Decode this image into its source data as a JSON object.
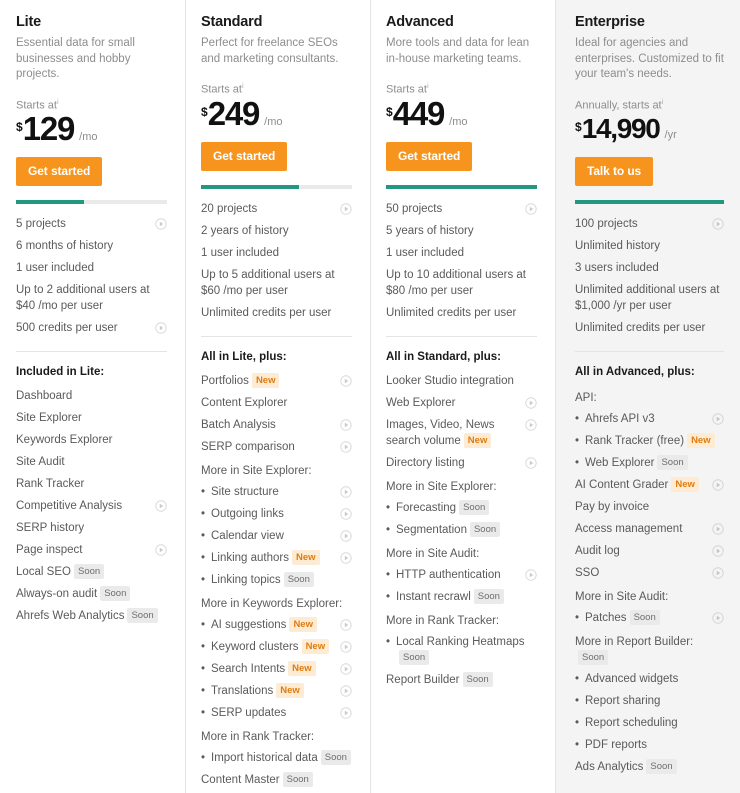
{
  "badges": {
    "new": "New",
    "soon": "Soon"
  },
  "colors": {
    "accent": "#f7941d",
    "meter": "#23977f",
    "badge_new_bg": "#fdecd3",
    "badge_new_text": "#e07b10",
    "featured_bg": "#f4f4f4"
  },
  "common": {
    "info_marker": "i",
    "starts_at": "Starts at",
    "annually_starts_at": "Annually, starts at"
  },
  "plans": [
    {
      "name": "Lite",
      "description": "Essential data for small businesses and hobby projects.",
      "starts_label": "Starts at",
      "currency": "$",
      "amount": "129",
      "period": "/mo",
      "cta": "Get started",
      "meter_percent": 45,
      "limits": [
        {
          "text": "5 projects",
          "icon": true
        },
        {
          "text": "6 months of history",
          "icon": false
        },
        {
          "text": "1 user included",
          "icon": false
        },
        {
          "text": "Up to 2 additional users at $40 /mo per user",
          "icon": false
        },
        {
          "text": "500 credits per user",
          "icon": true
        }
      ],
      "section_title": "Included in Lite:",
      "features": [
        {
          "kind": "item",
          "text": "Dashboard",
          "icon": false
        },
        {
          "kind": "item",
          "text": "Site Explorer",
          "icon": false
        },
        {
          "kind": "item",
          "text": "Keywords Explorer",
          "icon": false
        },
        {
          "kind": "item",
          "text": "Site Audit",
          "icon": false
        },
        {
          "kind": "item",
          "text": "Rank Tracker",
          "icon": false
        },
        {
          "kind": "item",
          "text": "Competitive Analysis",
          "icon": true
        },
        {
          "kind": "item",
          "text": "SERP history",
          "icon": false
        },
        {
          "kind": "item",
          "text": "Page inspect",
          "icon": true
        },
        {
          "kind": "item",
          "text": "Local SEO",
          "badge": "Soon",
          "icon": false
        },
        {
          "kind": "item",
          "text": "Always-on audit",
          "badge": "Soon",
          "icon": false
        },
        {
          "kind": "item",
          "text": "Ahrefs Web Analytics",
          "badge": "Soon",
          "icon": false
        }
      ]
    },
    {
      "name": "Standard",
      "description": "Perfect for freelance SEOs and marketing consultants.",
      "starts_label": "Starts at",
      "currency": "$",
      "amount": "249",
      "period": "/mo",
      "cta": "Get started",
      "meter_percent": 65,
      "limits": [
        {
          "text": "20 projects",
          "icon": true
        },
        {
          "text": "2 years of history",
          "icon": false
        },
        {
          "text": "1 user included",
          "icon": false
        },
        {
          "text": "Up to 5 additional users at $60 /mo per user",
          "icon": false
        },
        {
          "text": "Unlimited credits per user",
          "icon": false
        }
      ],
      "section_title": "All in Lite, plus:",
      "features": [
        {
          "kind": "item",
          "text": "Portfolios",
          "badge": "New",
          "icon": true
        },
        {
          "kind": "item",
          "text": "Content Explorer",
          "icon": false
        },
        {
          "kind": "item",
          "text": "Batch Analysis",
          "icon": true
        },
        {
          "kind": "item",
          "text": "SERP comparison",
          "icon": true
        },
        {
          "kind": "subhead",
          "text": "More in Site Explorer:"
        },
        {
          "kind": "bullet",
          "text": "Site structure",
          "icon": true
        },
        {
          "kind": "bullet",
          "text": "Outgoing links",
          "icon": true
        },
        {
          "kind": "bullet",
          "text": "Calendar view",
          "icon": true
        },
        {
          "kind": "bullet",
          "text": "Linking authors",
          "badge": "New",
          "icon": true
        },
        {
          "kind": "bullet",
          "text": "Linking topics",
          "badge": "Soon",
          "icon": false
        },
        {
          "kind": "subhead",
          "text": "More in Keywords Explorer:"
        },
        {
          "kind": "bullet",
          "text": "AI suggestions",
          "badge": "New",
          "icon": true
        },
        {
          "kind": "bullet",
          "text": "Keyword clusters",
          "badge": "New",
          "icon": true
        },
        {
          "kind": "bullet",
          "text": "Search Intents",
          "badge": "New",
          "icon": true
        },
        {
          "kind": "bullet",
          "text": "Translations",
          "badge": "New",
          "icon": true
        },
        {
          "kind": "bullet",
          "text": "SERP updates",
          "icon": true
        },
        {
          "kind": "subhead",
          "text": "More in Rank Tracker:"
        },
        {
          "kind": "bullet",
          "text": "Import historical data",
          "badge": "Soon",
          "icon": false
        },
        {
          "kind": "item",
          "text": "Content Master",
          "badge": "Soon",
          "icon": false
        }
      ]
    },
    {
      "name": "Advanced",
      "description": "More tools and data for lean in-house marketing teams.",
      "starts_label": "Starts at",
      "currency": "$",
      "amount": "449",
      "period": "/mo",
      "cta": "Get started",
      "meter_percent": 100,
      "limits": [
        {
          "text": "50 projects",
          "icon": true
        },
        {
          "text": "5 years of history",
          "icon": false
        },
        {
          "text": "1 user included",
          "icon": false
        },
        {
          "text": "Up to 10 additional users at $80 /mo per user",
          "icon": false
        },
        {
          "text": "Unlimited credits per user",
          "icon": false
        }
      ],
      "section_title": "All in Standard, plus:",
      "features": [
        {
          "kind": "item",
          "text": "Looker Studio integration",
          "icon": false
        },
        {
          "kind": "item",
          "text": "Web Explorer",
          "icon": true
        },
        {
          "kind": "item",
          "text": "Images, Video, News search volume",
          "badge": "New",
          "icon": true
        },
        {
          "kind": "item",
          "text": "Directory listing",
          "icon": true
        },
        {
          "kind": "subhead",
          "text": "More in Site Explorer:"
        },
        {
          "kind": "bullet",
          "text": "Forecasting",
          "badge": "Soon",
          "icon": false
        },
        {
          "kind": "bullet",
          "text": "Segmentation",
          "badge": "Soon",
          "icon": false
        },
        {
          "kind": "subhead",
          "text": "More in Site Audit:"
        },
        {
          "kind": "bullet",
          "text": "HTTP authentication",
          "icon": true
        },
        {
          "kind": "bullet",
          "text": "Instant recrawl",
          "badge": "Soon",
          "icon": false
        },
        {
          "kind": "subhead",
          "text": "More in Rank Tracker:"
        },
        {
          "kind": "bullet",
          "text": "Local Ranking Heatmaps",
          "badge": "Soon",
          "icon": false
        },
        {
          "kind": "item",
          "text": "Report Builder",
          "badge": "Soon",
          "icon": false
        }
      ]
    },
    {
      "name": "Enterprise",
      "description": "Ideal for agencies and enterprises. Customized to fit your team's needs.",
      "starts_label": "Annually, starts at",
      "currency": "$",
      "amount": "14,990",
      "period": "/yr",
      "cta": "Talk to us",
      "meter_percent": 100,
      "featured": true,
      "limits": [
        {
          "text": "100 projects",
          "icon": true
        },
        {
          "text": "Unlimited history",
          "icon": false
        },
        {
          "text": "3 users included",
          "icon": false
        },
        {
          "text": "Unlimited additional users at $1,000 /yr per user",
          "icon": false
        },
        {
          "text": "Unlimited credits per user",
          "icon": false
        }
      ],
      "section_title": "All in Advanced, plus:",
      "features": [
        {
          "kind": "subhead",
          "text": "API:"
        },
        {
          "kind": "bullet",
          "text": "Ahrefs API v3",
          "icon": true
        },
        {
          "kind": "bullet",
          "text": "Rank Tracker (free)",
          "badge": "New",
          "icon": false
        },
        {
          "kind": "bullet",
          "text": "Web Explorer",
          "badge": "Soon",
          "icon": false
        },
        {
          "kind": "item",
          "text": "AI Content Grader",
          "badge": "New",
          "icon": true
        },
        {
          "kind": "item",
          "text": "Pay by invoice",
          "icon": false
        },
        {
          "kind": "item",
          "text": "Access management",
          "icon": true
        },
        {
          "kind": "item",
          "text": "Audit log",
          "icon": true
        },
        {
          "kind": "item",
          "text": "SSO",
          "icon": true
        },
        {
          "kind": "subhead",
          "text": "More in Site Audit:"
        },
        {
          "kind": "bullet",
          "text": "Patches",
          "badge": "Soon",
          "icon": true
        },
        {
          "kind": "subhead",
          "text": "More in Report Builder:",
          "badge": "Soon"
        },
        {
          "kind": "bullet",
          "text": "Advanced widgets",
          "icon": false
        },
        {
          "kind": "bullet",
          "text": "Report sharing",
          "icon": false
        },
        {
          "kind": "bullet",
          "text": "Report scheduling",
          "icon": false
        },
        {
          "kind": "bullet",
          "text": "PDF reports",
          "icon": false
        },
        {
          "kind": "item",
          "text": "Ads Analytics",
          "badge": "Soon",
          "icon": false
        }
      ]
    }
  ]
}
